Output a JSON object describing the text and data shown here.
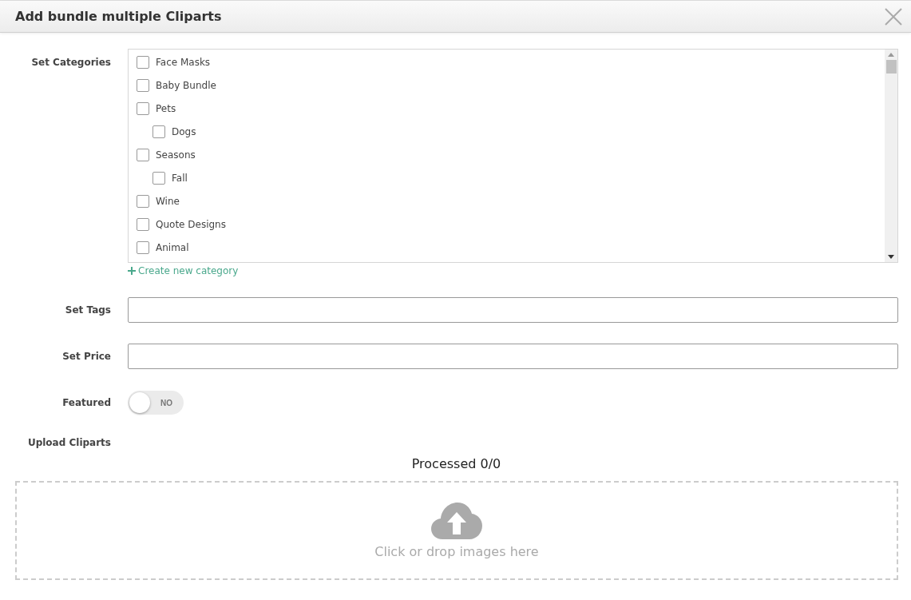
{
  "window": {
    "title": "Add bundle multiple Cliparts"
  },
  "categories": {
    "label": "Set Categories",
    "items": [
      {
        "label": "Face Masks",
        "checked": false
      },
      {
        "label": "Baby Bundle",
        "checked": false
      },
      {
        "label": "Pets",
        "checked": false,
        "children": [
          {
            "label": "Dogs",
            "checked": false
          }
        ]
      },
      {
        "label": "Seasons",
        "checked": false,
        "children": [
          {
            "label": "Fall",
            "checked": false
          }
        ]
      },
      {
        "label": "Wine",
        "checked": false
      },
      {
        "label": "Quote Designs",
        "checked": false
      },
      {
        "label": "Animal",
        "checked": false
      }
    ],
    "create_link": "Create new category"
  },
  "tags": {
    "label": "Set Tags"
  },
  "price": {
    "label": "Set Price"
  },
  "featured": {
    "label": "Featured",
    "on": false,
    "text": "NO"
  },
  "upload": {
    "label": "Upload Cliparts",
    "status": "Processed 0/0",
    "dropzone_text": "Click or drop images here"
  }
}
